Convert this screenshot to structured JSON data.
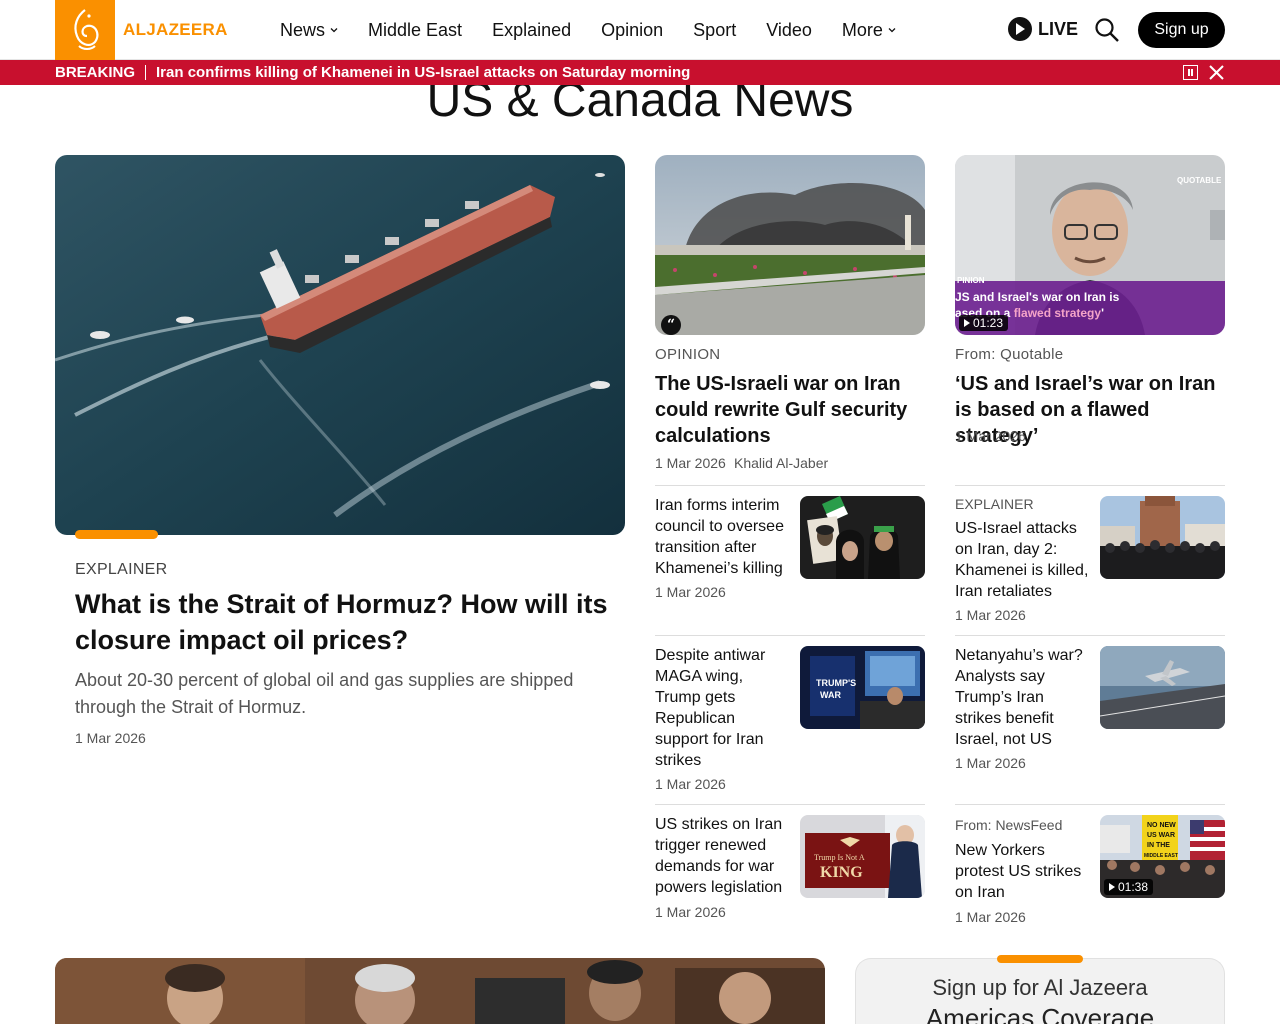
{
  "header": {
    "logo_text": "ALJAZEERA",
    "nav": [
      {
        "label": "News",
        "has_menu": true
      },
      {
        "label": "Middle East",
        "has_menu": false
      },
      {
        "label": "Explained",
        "has_menu": false
      },
      {
        "label": "Opinion",
        "has_menu": false
      },
      {
        "label": "Sport",
        "has_menu": false
      },
      {
        "label": "Video",
        "has_menu": false
      },
      {
        "label": "More",
        "has_menu": true
      }
    ],
    "live_label": "LIVE",
    "signup_label": "Sign up"
  },
  "breaking": {
    "label": "BREAKING",
    "text": "Iran confirms killing of Khamenei in US-Israel attacks on Saturday morning"
  },
  "page_title": "US & Canada News",
  "featured": {
    "kicker": "EXPLAINER",
    "title": "What is the Strait of Hormuz? How will its closure impact oil prices?",
    "summary": "About 20-30 percent of global oil and gas supplies are shipped through the Strait of Hormuz.",
    "date": "1 Mar 2026"
  },
  "card_left": {
    "kicker": "OPINION",
    "title": "The US-Israeli war on Iran could rewrite Gulf security calculations",
    "date": "1 Mar 2026",
    "author": "Khalid Al-Jaber",
    "badge": "“"
  },
  "card_right": {
    "kicker": "From: Quotable",
    "title": "‘US and Israel’s war on Iran is based on a flawed strategy’",
    "date": "1 Mar 2026",
    "duration": "01:23",
    "overlay_tag": "PINION",
    "overlay_line1": "JS and Israel's war on Iran is",
    "overlay_line2a": "ased on a ",
    "overlay_line2b": "flawed strategy",
    "overlay_line2c": "'",
    "overlay_brand": "QUOTABLE"
  },
  "list_left": [
    {
      "title": "Iran forms interim council to oversee transition after Khamenei’s killing",
      "date": "1 Mar 2026"
    },
    {
      "title": "Despite antiwar MAGA wing, Trump gets Republican support for Iran strikes",
      "date": "1 Mar 2026",
      "image_text": [
        "TRUMP'S",
        "WAR"
      ]
    },
    {
      "title": "US strikes on Iran trigger renewed demands for war powers legislation",
      "date": "1 Mar 2026",
      "image_text": [
        "Trump Is Not A",
        "KING"
      ]
    }
  ],
  "list_right": [
    {
      "kicker": "EXPLAINER",
      "title": "US-Israel attacks on Iran, day 2: Khamenei is killed, Iran retaliates",
      "date": "1 Mar 2026"
    },
    {
      "title": "Netanyahu’s war? Analysts say Trump’s Iran strikes benefit Israel, not US",
      "date": "1 Mar 2026"
    },
    {
      "kicker": "From: NewsFeed",
      "title": "New Yorkers protest US strikes on Iran",
      "date": "1 Mar 2026",
      "duration": "01:38",
      "image_text": [
        "NO NEW",
        "US WAR",
        "IN THE",
        "MIDDLE EAST"
      ]
    }
  ],
  "newsletter": {
    "line1": "Sign up for Al Jazeera",
    "line2": "Americas Coverage"
  },
  "colors": {
    "brand_orange": "#fa9000",
    "breaking_red": "#c8102e"
  },
  "icons": [
    "aljazeera-logo-icon",
    "chevron-down-icon",
    "play-icon",
    "search-icon",
    "pause-icon",
    "close-icon",
    "quote-icon"
  ]
}
